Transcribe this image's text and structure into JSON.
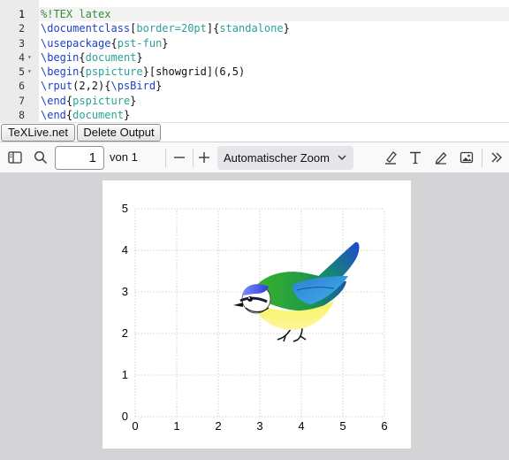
{
  "editor": {
    "lines": [
      {
        "num": "1",
        "fold": "",
        "tokens": [
          {
            "t": "%!TEX latex",
            "c": "cm"
          }
        ]
      },
      {
        "num": "2",
        "fold": "",
        "tokens": [
          {
            "t": "\\documentclass",
            "c": "kw"
          },
          {
            "t": "[",
            "c": "pl"
          },
          {
            "t": "border=20pt",
            "c": "ar"
          },
          {
            "t": "]{",
            "c": "pl"
          },
          {
            "t": "standalone",
            "c": "ar"
          },
          {
            "t": "}",
            "c": "pl"
          }
        ]
      },
      {
        "num": "3",
        "fold": "",
        "tokens": [
          {
            "t": "\\usepackage",
            "c": "kw"
          },
          {
            "t": "{",
            "c": "pl"
          },
          {
            "t": "pst-fun",
            "c": "ar"
          },
          {
            "t": "}",
            "c": "pl"
          }
        ]
      },
      {
        "num": "4",
        "fold": "▾",
        "tokens": [
          {
            "t": "\\begin",
            "c": "kw"
          },
          {
            "t": "{",
            "c": "pl"
          },
          {
            "t": "document",
            "c": "ar"
          },
          {
            "t": "}",
            "c": "pl"
          }
        ]
      },
      {
        "num": "5",
        "fold": "▾",
        "tokens": [
          {
            "t": "\\begin",
            "c": "kw"
          },
          {
            "t": "{",
            "c": "pl"
          },
          {
            "t": "pspicture",
            "c": "ar"
          },
          {
            "t": "}[showgrid](6,5)",
            "c": "pl"
          }
        ]
      },
      {
        "num": "6",
        "fold": "",
        "tokens": [
          {
            "t": "\\rput",
            "c": "kw"
          },
          {
            "t": "(2,2){",
            "c": "pl"
          },
          {
            "t": "\\psBird",
            "c": "kw"
          },
          {
            "t": "}",
            "c": "pl"
          }
        ]
      },
      {
        "num": "7",
        "fold": "",
        "tokens": [
          {
            "t": "\\end",
            "c": "kw"
          },
          {
            "t": "{",
            "c": "pl"
          },
          {
            "t": "pspicture",
            "c": "ar"
          },
          {
            "t": "}",
            "c": "pl"
          }
        ]
      },
      {
        "num": "8",
        "fold": "",
        "tokens": [
          {
            "t": "\\end",
            "c": "kw"
          },
          {
            "t": "{",
            "c": "pl"
          },
          {
            "t": "document",
            "c": "ar"
          },
          {
            "t": "}",
            "c": "pl"
          }
        ]
      }
    ]
  },
  "buttons": {
    "texlive": "TeXLive.net",
    "delete_output": "Delete Output"
  },
  "pdf_toolbar": {
    "page_number": "1",
    "page_of": "von 1",
    "zoom_label": "Automatischer Zoom",
    "icons": {
      "sidebar": "sidebar-toggle-icon",
      "search": "search-icon",
      "zoom_out": "minus-icon",
      "zoom_in": "plus-icon",
      "highlight": "highlighter-icon",
      "text": "text-tool-icon",
      "draw": "pen-icon",
      "image": "image-icon",
      "more": "chevron-double-right-icon"
    }
  },
  "figure": {
    "x_ticks": [
      "0",
      "1",
      "2",
      "3",
      "4",
      "5",
      "6"
    ],
    "y_ticks": [
      "0",
      "1",
      "2",
      "3",
      "4",
      "5"
    ],
    "grid": "dotted",
    "content": "bird (blue tit) drawing"
  },
  "colors": {
    "comment": "#2f8d3b",
    "keyword": "#1d3fc7",
    "argument": "#2aa198",
    "viewer_bg": "#d4d4d7"
  }
}
